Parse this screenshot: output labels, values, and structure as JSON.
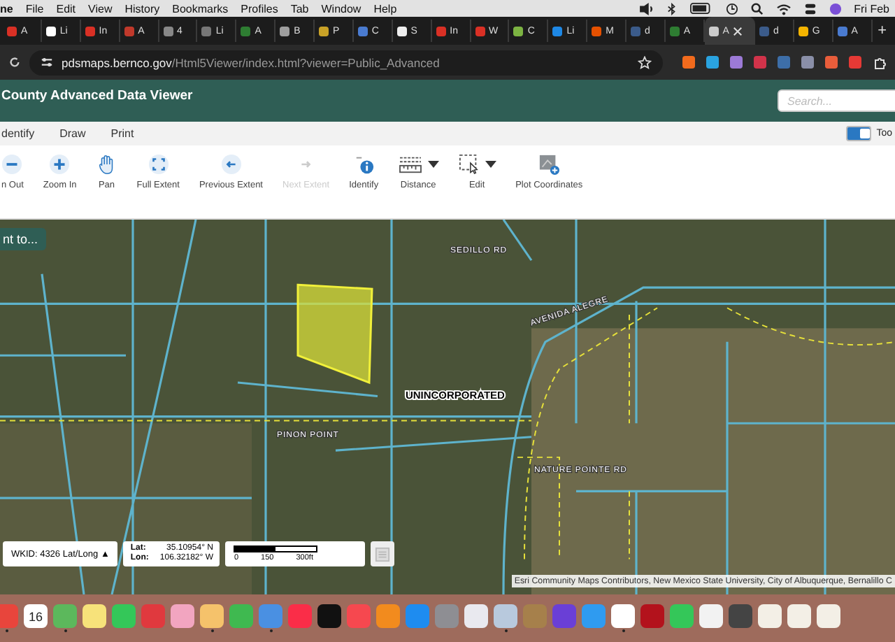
{
  "menubar": {
    "items": [
      "ne",
      "File",
      "Edit",
      "View",
      "History",
      "Bookmarks",
      "Profiles",
      "Tab",
      "Window",
      "Help"
    ],
    "clock": "Fri Feb"
  },
  "browser_tabs": [
    {
      "label": "A",
      "color": "#d93025",
      "selected": false
    },
    {
      "label": "Li",
      "color": "#ffffff",
      "selected": false
    },
    {
      "label": "In",
      "color": "#d93025",
      "selected": false
    },
    {
      "label": "A",
      "color": "#c0392b",
      "selected": false
    },
    {
      "label": "4",
      "color": "#888888",
      "selected": false
    },
    {
      "label": "Li",
      "color": "#777777",
      "selected": false
    },
    {
      "label": "A",
      "color": "#2e7d32",
      "selected": false
    },
    {
      "label": "B",
      "color": "#9e9e9e",
      "selected": false
    },
    {
      "label": "P",
      "color": "#c9a227",
      "selected": false
    },
    {
      "label": "C",
      "color": "#4a7bd0",
      "selected": false
    },
    {
      "label": "S",
      "color": "#eeeeee",
      "selected": false
    },
    {
      "label": "In",
      "color": "#d93025",
      "selected": false
    },
    {
      "label": "W",
      "color": "#d93025",
      "selected": false
    },
    {
      "label": "C",
      "color": "#7cb342",
      "selected": false
    },
    {
      "label": "Li",
      "color": "#1e88e5",
      "selected": false
    },
    {
      "label": "M",
      "color": "#e65100",
      "selected": false
    },
    {
      "label": "d",
      "color": "#3b5b8a",
      "selected": false
    },
    {
      "label": "A",
      "color": "#2e7d32",
      "selected": false
    },
    {
      "label": "A",
      "color": "#cccccc",
      "selected": true
    },
    {
      "label": "d",
      "color": "#3b5b8a",
      "selected": false
    },
    {
      "label": "G",
      "color": "#f4b400",
      "selected": false
    },
    {
      "label": "A",
      "color": "#4a7bd0",
      "selected": false
    }
  ],
  "new_tab": "+",
  "address_bar": {
    "domain": "pdsmaps.bernco.gov",
    "path": "/Html5Viewer/index.html?viewer=Public_Advanced"
  },
  "app_header": {
    "title": "County Advanced Data Viewer",
    "search": {
      "placeholder": "Search..."
    }
  },
  "menu_tabs": [
    "dentify",
    "Draw",
    "Print"
  ],
  "toolbar_toggle": {
    "on": true,
    "label": "Too"
  },
  "tools": [
    {
      "kind": "zoomout",
      "label": "n Out",
      "disabled": false,
      "dropdown": false
    },
    {
      "kind": "zoomin",
      "label": "Zoom In",
      "disabled": false,
      "dropdown": false
    },
    {
      "kind": "pan",
      "label": "Pan",
      "disabled": false,
      "dropdown": false
    },
    {
      "kind": "fullextent",
      "label": "Full Extent",
      "disabled": false,
      "dropdown": false
    },
    {
      "kind": "previous",
      "label": "Previous Extent",
      "disabled": false,
      "dropdown": false
    },
    {
      "kind": "next",
      "label": "Next Extent",
      "disabled": true,
      "dropdown": false
    },
    {
      "kind": "identify",
      "label": "Identify",
      "disabled": false,
      "dropdown": false
    },
    {
      "kind": "distance",
      "label": "Distance",
      "disabled": false,
      "dropdown": true
    },
    {
      "kind": "edit",
      "label": "Edit",
      "disabled": false,
      "dropdown": true
    },
    {
      "kind": "plot",
      "label": "Plot Coordinates",
      "disabled": false,
      "dropdown": false
    }
  ],
  "map": {
    "jump_button": "nt to...",
    "labels": [
      {
        "kind": "road",
        "text": "SEDILLO RD"
      },
      {
        "kind": "road",
        "text": "AVENIDA ALEGRE"
      },
      {
        "kind": "area",
        "text": "UNINCORPORATED"
      },
      {
        "kind": "road",
        "text": "PINON POINT"
      },
      {
        "kind": "road",
        "text": "NATURE POINTE RD"
      }
    ],
    "coordinate_system": "WKID: 4326 Lat/Long ▲",
    "lat_label": "Lat:",
    "lat": "35.10954° N",
    "lon_label": "Lon:",
    "lon": "106.32182° W",
    "scale": [
      "0",
      "150",
      "300ft"
    ],
    "attribution": "Esri Community Maps Contributors, New Mexico State University, City of Albuquerque, Bernalillo C"
  },
  "dock": [
    {
      "color": "#e8453c",
      "running": true
    },
    {
      "color": "#ffffff",
      "date": "16",
      "running": false
    },
    {
      "color": "#5cb85c",
      "running": true
    },
    {
      "color": "#f7e27a",
      "running": false
    },
    {
      "color": "#34c759",
      "running": false
    },
    {
      "color": "#e0393e",
      "running": false
    },
    {
      "color": "#f2a5c0",
      "running": false
    },
    {
      "color": "#f5c26b",
      "running": true
    },
    {
      "color": "#3fb950",
      "running": false
    },
    {
      "color": "#4a90e2",
      "running": true
    },
    {
      "color": "#fa2d48",
      "running": false
    },
    {
      "color": "#111111",
      "running": false
    },
    {
      "color": "#f6484f",
      "running": false
    },
    {
      "color": "#f28b1e",
      "running": false
    },
    {
      "color": "#1e8cf0",
      "running": false
    },
    {
      "color": "#8e8e93",
      "running": false
    },
    {
      "color": "#e9e9ef",
      "running": false
    },
    {
      "color": "#b8c9dd",
      "running": true
    },
    {
      "color": "#a6804b",
      "running": false
    },
    {
      "color": "#6a3fd6",
      "running": false
    },
    {
      "color": "#2f9bf0",
      "running": false
    },
    {
      "color": "#ffffff",
      "running": true
    },
    {
      "color": "#b3121c",
      "running": false
    },
    {
      "color": "#34c759",
      "running": false
    },
    {
      "color": "#f2f2f2",
      "running": false
    },
    {
      "color": "#444444",
      "running": false
    },
    {
      "color": "#f3efe6",
      "running": false
    },
    {
      "color": "#f3efe6",
      "running": false
    },
    {
      "color": "#f3efe6",
      "running": false
    }
  ]
}
